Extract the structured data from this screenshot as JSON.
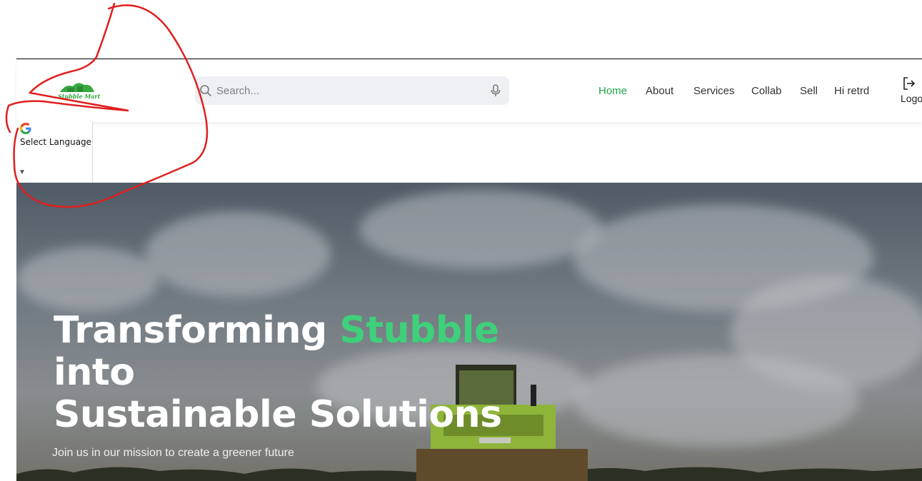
{
  "header": {
    "logo_text": "Stubble Mart",
    "search": {
      "placeholder": "Search..."
    },
    "nav": [
      {
        "label": "Home",
        "active": true
      },
      {
        "label": "About"
      },
      {
        "label": "Services"
      },
      {
        "label": "Collab"
      },
      {
        "label": "Sell"
      },
      {
        "label": "Hi retrd"
      }
    ],
    "logout_label": "Logout"
  },
  "language": {
    "label": "Select Language"
  },
  "hero": {
    "title_part1": "Transforming ",
    "title_accent": "Stubble",
    "title_line2": "into",
    "title_line3": "Sustainable Solutions",
    "subtitle": "Join us in our mission to create a greener future"
  },
  "colors": {
    "accent": "#22a24a",
    "hero_accent": "#3ed07a",
    "annotation": "#e01f1f"
  },
  "icons": [
    "search-icon",
    "microphone-icon",
    "logout-icon",
    "google-icon",
    "caret-down-icon"
  ]
}
